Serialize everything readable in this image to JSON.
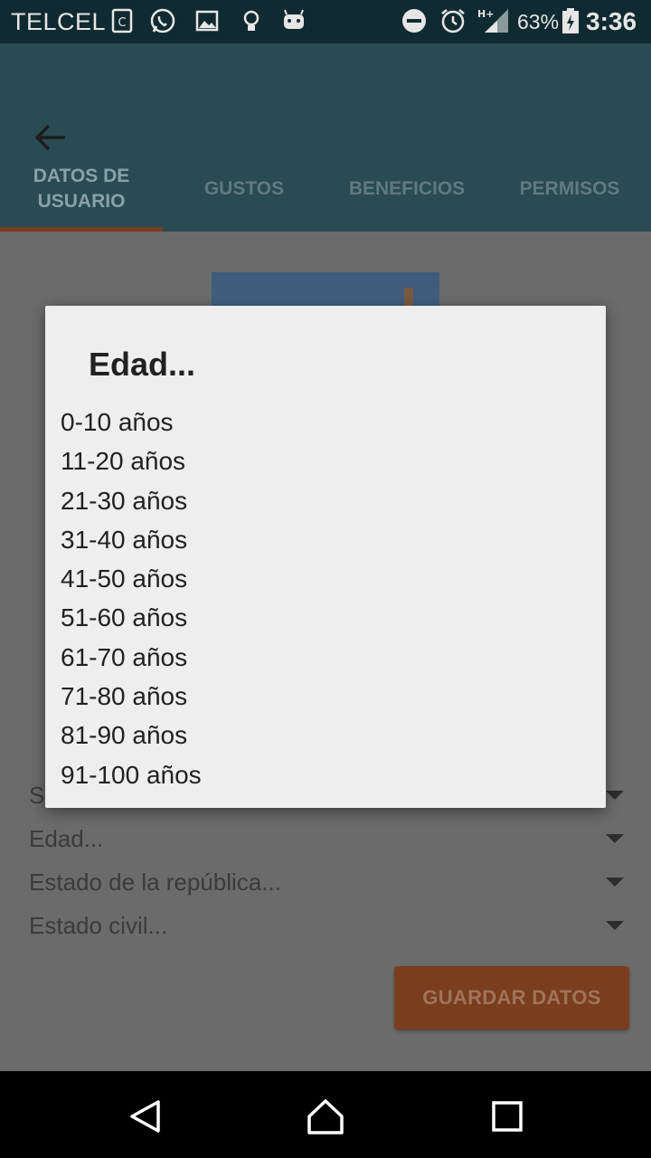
{
  "status_bar": {
    "carrier": "TELCEL",
    "battery": "63%",
    "time": "3:36",
    "network": "H+",
    "icons": [
      "sim-icon",
      "whatsapp-icon",
      "gallery-icon",
      "lightbulb-icon",
      "android-icon",
      "do-not-disturb-icon",
      "alarm-icon",
      "signal-icon",
      "battery-icon"
    ]
  },
  "appbar": {
    "tabs": [
      {
        "label": "DATOS DE USUARIO"
      },
      {
        "label": "GUSTOS"
      },
      {
        "label": "BENEFICIOS"
      },
      {
        "label": "PERMISOS"
      }
    ]
  },
  "form": {
    "spinners": [
      {
        "label": "Sexo..."
      },
      {
        "label": "Edad..."
      },
      {
        "label": "Estado de la república..."
      },
      {
        "label": "Estado civil..."
      }
    ],
    "save_label": "GUARDAR DATOS"
  },
  "dialog": {
    "title": "Edad...",
    "options": [
      "0-10 años",
      "11-20 años",
      "21-30 años",
      "31-40 años",
      "41-50 años",
      "51-60 años",
      "61-70 años",
      "71-80 años",
      "81-90 años",
      "91-100 años"
    ]
  },
  "colors": {
    "status_bar": "#0f2b31",
    "app_bar": "#294b52",
    "accent": "#d9622c",
    "scrim": "#6b6b6b",
    "dialog_bg": "#eeeeee"
  }
}
